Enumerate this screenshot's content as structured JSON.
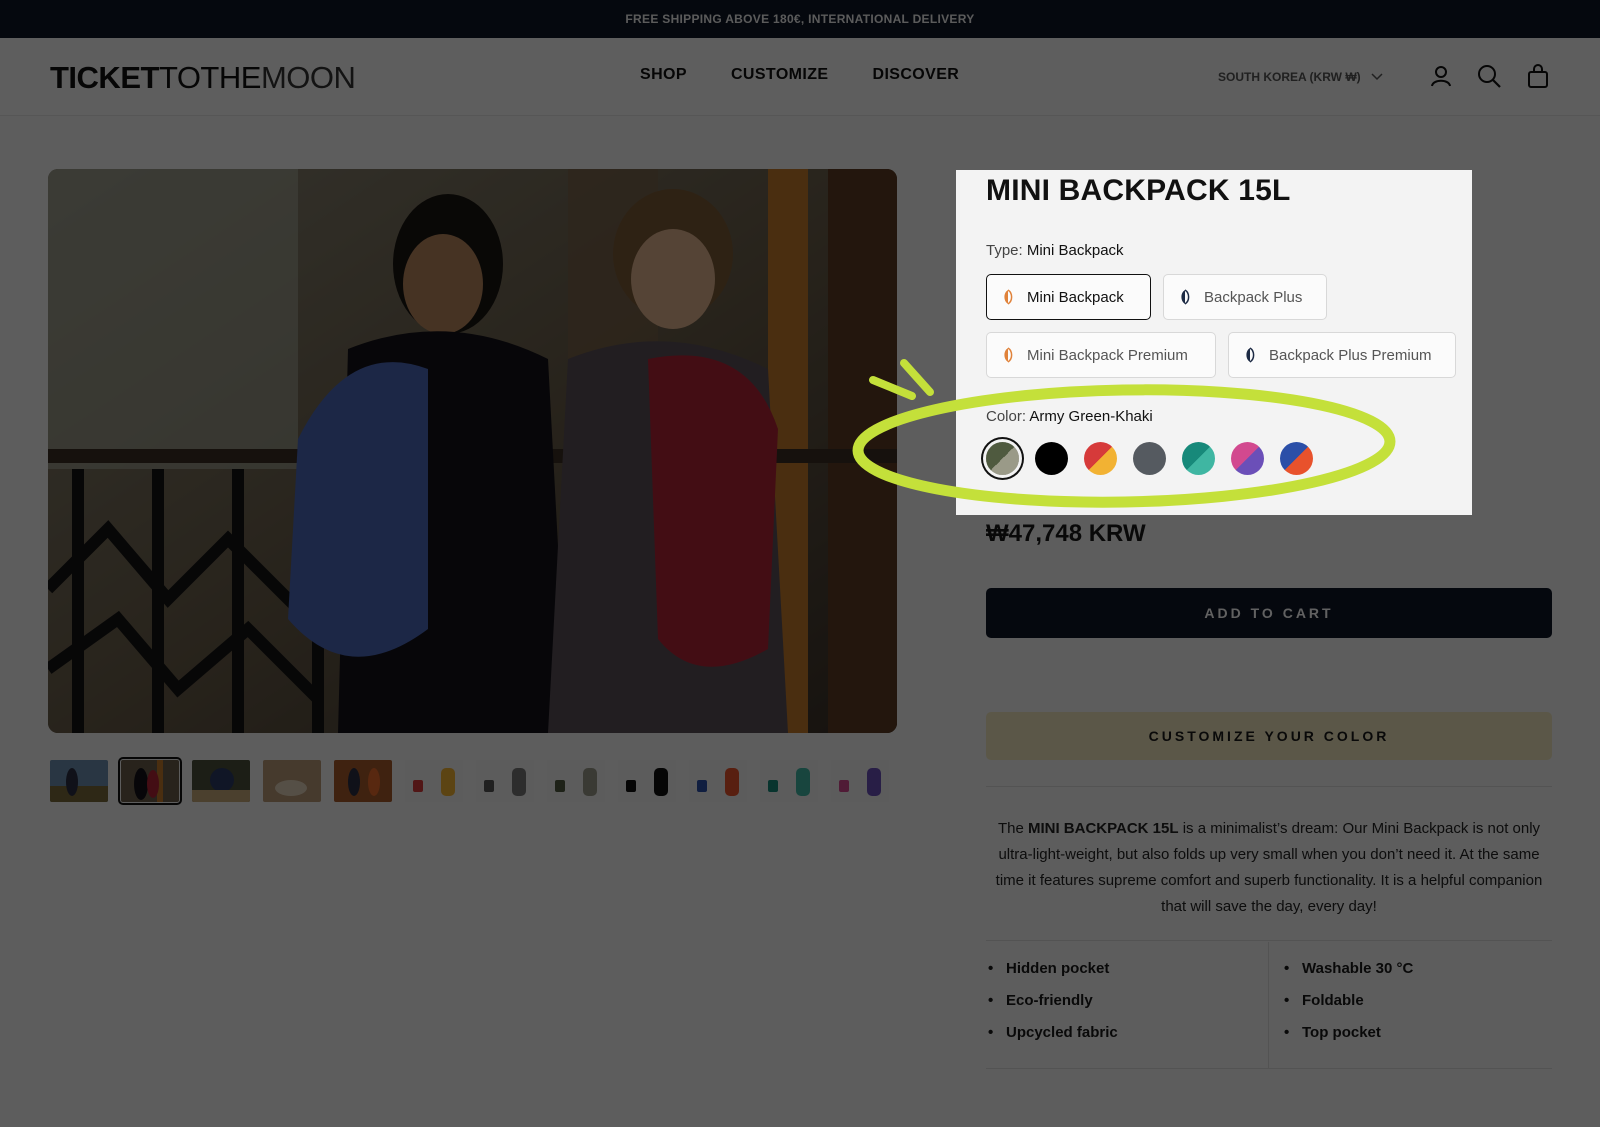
{
  "announcement": "FREE SHIPPING ABOVE 180€, INTERNATIONAL DELIVERY",
  "header": {
    "logo_bold": "TICKET",
    "logo_mid": "TOTHE",
    "logo_light": "MOON",
    "nav": [
      "SHOP",
      "CUSTOMIZE",
      "DISCOVER"
    ],
    "region": "SOUTH KOREA (KRW ₩)",
    "icons": [
      "account-icon",
      "search-icon",
      "cart-icon"
    ]
  },
  "product": {
    "title": "MINI BACKPACK 15L",
    "type_label": "Type:",
    "type_value": "Mini Backpack",
    "types": [
      {
        "label": "Mini Backpack",
        "selected": true,
        "icon_color": "#e0823a"
      },
      {
        "label": "Backpack Plus",
        "selected": false,
        "icon_color": "#1c2a44"
      },
      {
        "label": "Mini Backpack Premium",
        "selected": false,
        "icon_color": "#e0823a"
      },
      {
        "label": "Backpack Plus Premium",
        "selected": false,
        "icon_color": "#1c2a44"
      }
    ],
    "color_label": "Color:",
    "color_value": "Army Green-Khaki",
    "swatches": [
      {
        "name": "Army Green-Khaki",
        "a": "#4f5a3f",
        "b": "#9a9a88",
        "selected": true
      },
      {
        "name": "Black",
        "a": "#000000",
        "b": "#000000",
        "selected": false
      },
      {
        "name": "Red-Yellow",
        "a": "#d63a3a",
        "b": "#f2b233",
        "selected": false
      },
      {
        "name": "Grey",
        "a": "#555a60",
        "b": "#555a60",
        "selected": false
      },
      {
        "name": "Teal-Green",
        "a": "#17897a",
        "b": "#3fb6a2",
        "selected": false
      },
      {
        "name": "Pink-Purple",
        "a": "#d2498f",
        "b": "#6b4fb8",
        "selected": false
      },
      {
        "name": "Blue-Orange",
        "a": "#2b4fa8",
        "b": "#e8522c",
        "selected": false
      }
    ],
    "price": "₩47,748 KRW",
    "add_to_cart": "ADD TO CART",
    "customize": "CUSTOMIZE YOUR COLOR",
    "description_pre": "The ",
    "description_bold": "MINI BACKPACK 15L",
    "description_post": " is a minimalist’s dream: Our Mini Backpack is not only ultra-light-weight, but also folds up very small when you don’t need it. At the same time it features supreme comfort and superb functionality. It is a helpful companion that will save the day, every day!",
    "features_left": [
      "Hidden pocket",
      "Eco-friendly",
      "Upcycled fabric"
    ],
    "features_right": [
      "Washable 30 °C",
      "Foldable",
      "Top pocket"
    ]
  },
  "thumbnails": {
    "count": 12,
    "selected_index": 1
  },
  "colors": {
    "navy": "#0e1626",
    "highlight_green": "#c4e03a",
    "customize_bg": "#efe5bd"
  }
}
